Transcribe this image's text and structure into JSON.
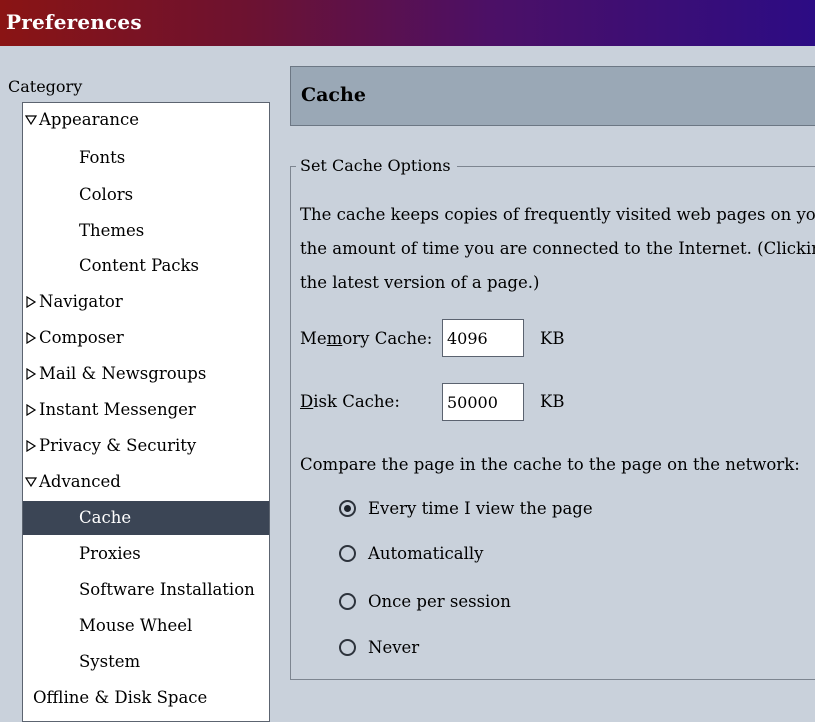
{
  "window": {
    "title": "Preferences"
  },
  "sidebar": {
    "label": "Category",
    "items": [
      {
        "label": "Appearance",
        "level": 0,
        "twisty": "expanded"
      },
      {
        "label": "Fonts",
        "level": 1
      },
      {
        "label": "Colors",
        "level": 1
      },
      {
        "label": "Themes",
        "level": 1
      },
      {
        "label": "Content Packs",
        "level": 1
      },
      {
        "label": "Navigator",
        "level": 0,
        "twisty": "collapsed"
      },
      {
        "label": "Composer",
        "level": 0,
        "twisty": "collapsed"
      },
      {
        "label": "Mail & Newsgroups",
        "level": 0,
        "twisty": "collapsed"
      },
      {
        "label": "Instant Messenger",
        "level": 0,
        "twisty": "collapsed"
      },
      {
        "label": "Privacy & Security",
        "level": 0,
        "twisty": "collapsed"
      },
      {
        "label": "Advanced",
        "level": 0,
        "twisty": "expanded"
      },
      {
        "label": "Cache",
        "level": 1,
        "selected": true
      },
      {
        "label": "Proxies",
        "level": 1
      },
      {
        "label": "Software Installation",
        "level": 1
      },
      {
        "label": "Mouse Wheel",
        "level": 1
      },
      {
        "label": "System",
        "level": 1
      },
      {
        "label": "Offline & Disk Space",
        "level": 0
      }
    ]
  },
  "panel": {
    "title": "Cache",
    "group_label": "Set Cache Options",
    "description": [
      "The cache keeps copies of frequently visited web pages on your",
      "the amount of time you are connected to the Internet. (Clicking R",
      "the latest version of a page.)"
    ],
    "memory_cache": {
      "label_pre": "Me",
      "label_accel": "m",
      "label_post": "ory Cache:",
      "value": "4096",
      "unit": "KB"
    },
    "disk_cache": {
      "label_pre": "",
      "label_accel": "D",
      "label_post": "isk Cache:",
      "value": "50000",
      "unit": "KB"
    },
    "compare_label": "Compare the page in the cache to the page on the network:",
    "options": [
      {
        "label": "Every time I view the page",
        "checked": true
      },
      {
        "label": "Automatically",
        "checked": false
      },
      {
        "label": "Once per session",
        "checked": false
      },
      {
        "label": "Never",
        "checked": false
      }
    ]
  }
}
